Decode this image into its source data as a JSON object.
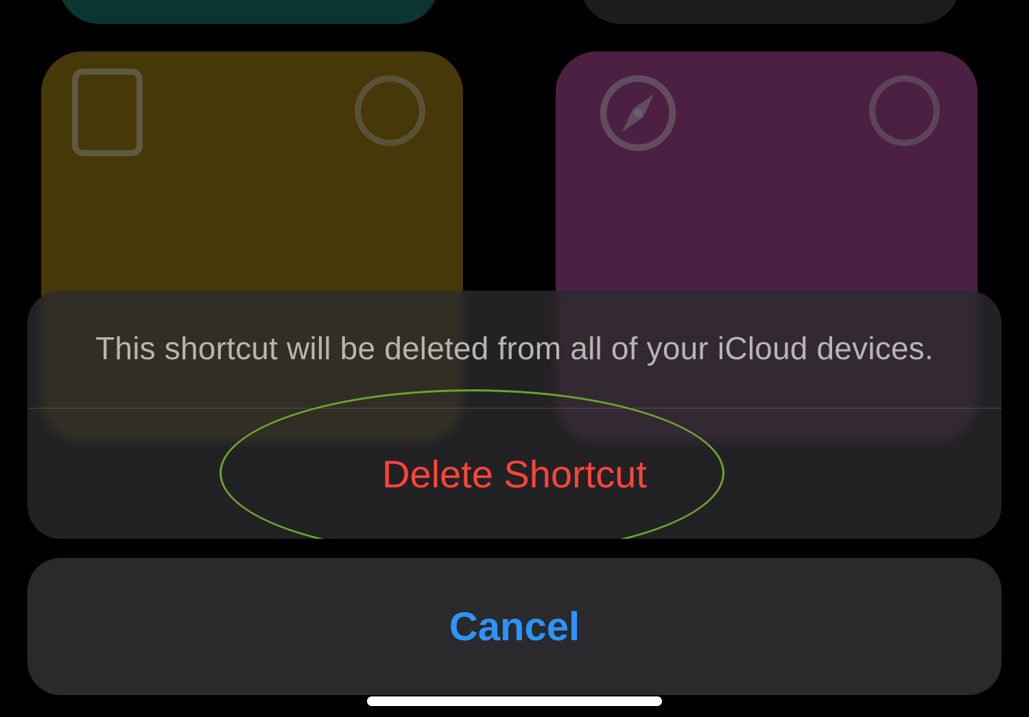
{
  "sheet": {
    "message": "This shortcut will be deleted from all of your iCloud devices.",
    "destructive_label": "Delete Shortcut",
    "cancel_label": "Cancel"
  },
  "tiles": {
    "teal_icon": "",
    "grey_icon": "",
    "yellow_icon": "rectangle-icon",
    "pink_icon": "compass-icon"
  },
  "annotation": {
    "color": "#6da52c"
  }
}
